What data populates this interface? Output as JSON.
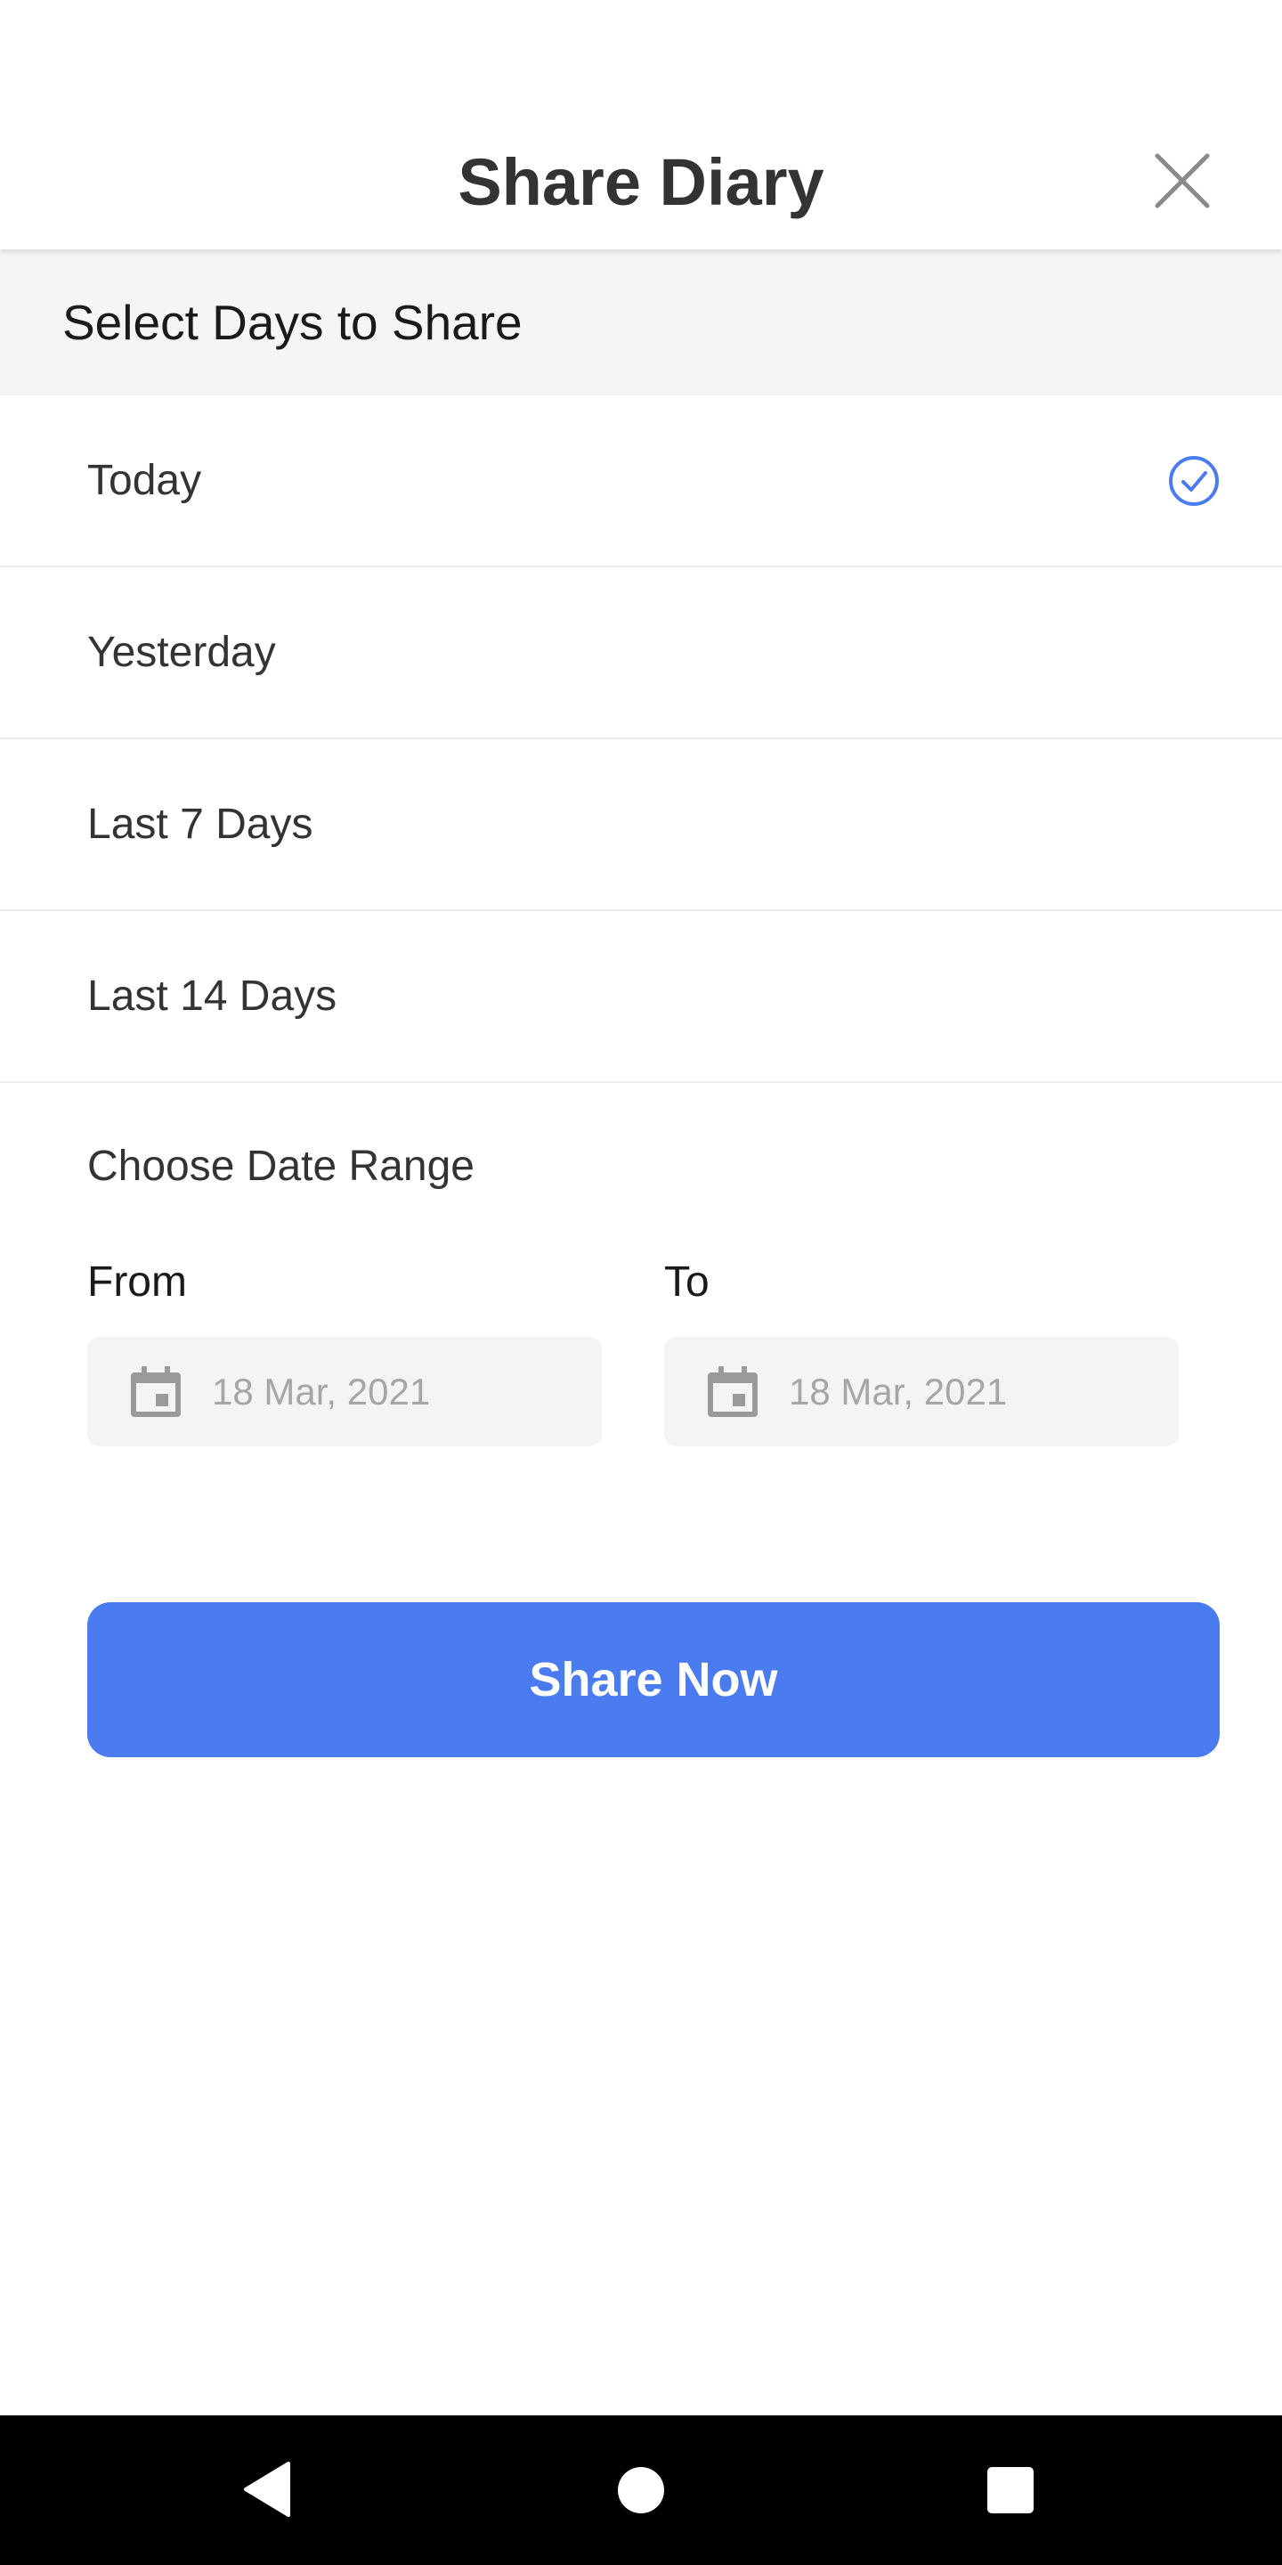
{
  "header": {
    "title": "Share Diary",
    "close_icon": "close-icon"
  },
  "section": {
    "title": "Select Days to Share"
  },
  "options": [
    {
      "label": "Today",
      "selected": true
    },
    {
      "label": "Yesterday",
      "selected": false
    },
    {
      "label": "Last 7 Days",
      "selected": false
    },
    {
      "label": "Last 14 Days",
      "selected": false
    }
  ],
  "date_range": {
    "label": "Choose Date Range",
    "from_label": "From",
    "to_label": "To",
    "from_value": "18 Mar, 2021",
    "to_value": "18 Mar, 2021",
    "icon": "calendar-icon"
  },
  "share_button": {
    "label": "Share Now"
  },
  "nav_bar": {
    "back_icon": "back-icon",
    "home_icon": "home-icon",
    "recents_icon": "recents-icon"
  },
  "colors": {
    "accent": "#4a7cef",
    "header_text": "#333333",
    "section_bg": "#f5f5f5",
    "field_bg": "#f4f4f4",
    "placeholder_text": "#a6a6a6",
    "nav_bar": "#000000"
  }
}
